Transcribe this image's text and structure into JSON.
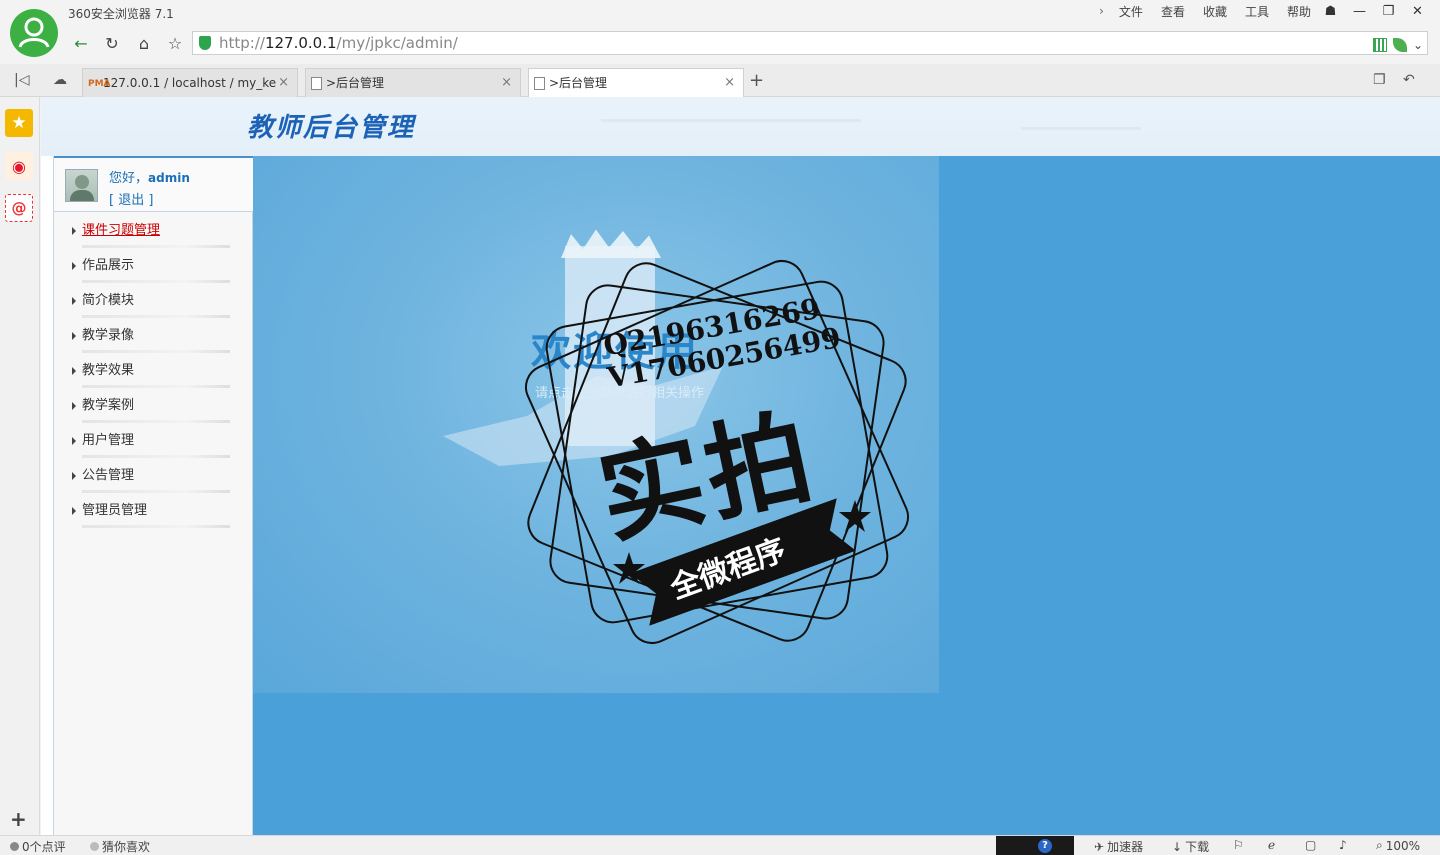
{
  "browser": {
    "name": "360安全浏览器 7.1",
    "menu": [
      "文件",
      "查看",
      "收藏",
      "工具",
      "帮助"
    ],
    "url_scheme": "http://",
    "url_host": "127.0.0.1",
    "url_path": "/my/jpkc/admin/",
    "tabs": [
      {
        "label": "127.0.0.1 / localhost / my_ke",
        "icon": "pma-icon",
        "active": false
      },
      {
        "label": ">后台管理",
        "icon": "page-icon",
        "active": false
      },
      {
        "label": ">后台管理",
        "icon": "page-icon",
        "active": true
      }
    ]
  },
  "header": {
    "title": "教师后台管理"
  },
  "user": {
    "greeting": "您好，",
    "name": "admin",
    "logout": "[ 退出 ]"
  },
  "nav": {
    "items": [
      {
        "label": "课件习题管理",
        "active": true
      },
      {
        "label": "作品展示",
        "active": false
      },
      {
        "label": "简介模块",
        "active": false
      },
      {
        "label": "教学录像",
        "active": false
      },
      {
        "label": "教学效果",
        "active": false
      },
      {
        "label": "教学案例",
        "active": false
      },
      {
        "label": "用户管理",
        "active": false
      },
      {
        "label": "公告管理",
        "active": false
      },
      {
        "label": "管理员管理",
        "active": false
      }
    ]
  },
  "welcome": {
    "title": "欢迎使用",
    "subtitle": "请点击左边菜单进行相关操作"
  },
  "watermark": {
    "qq": "Q2196316269",
    "v": "V17060256499",
    "big": "实拍",
    "ribbon": "全微程序"
  },
  "statusbar": {
    "reviews": "0个点评",
    "guess": "猜你喜欢",
    "accelerator": "加速器",
    "download": "下载",
    "zoom": "100%"
  },
  "colors": {
    "link_blue": "#1c6fb8",
    "active_red": "#cc0000",
    "main_bg": "#4aa0d8"
  }
}
